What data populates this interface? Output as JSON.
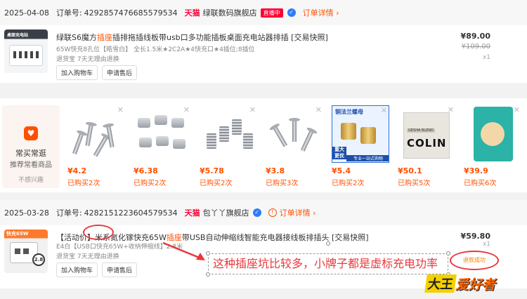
{
  "orders": [
    {
      "date": "2025-04-08",
      "order_no_label": "订单号:",
      "order_no": "4292857476685579534",
      "platform": "天猫",
      "shop": "绿联数码旗舰店",
      "live_badge": "直播中",
      "detail_label": "订单详情",
      "thumb_text": "桌面充电站",
      "title_pre": "绿联S6魔方",
      "title_hl": "插座",
      "title_post": "插排拖插线板带usb口多功能插板桌面充电站器排插 [交易快照]",
      "spec": "65W快充8孔位【皓雪白】 全长1.5米★2C2A★4快充口★4插位;8插位",
      "service": "退货宝 7天无理由退换",
      "buttons": [
        "加入购物车",
        "申请售后"
      ],
      "price": "¥89.00",
      "original_price": "¥109.00",
      "qty": "x1"
    },
    {
      "date": "2025-03-28",
      "order_no_label": "订单号:",
      "order_no": "4282151223604579534",
      "platform": "天猫",
      "shop": "包丫丫旗舰店",
      "detail_label": "订单详情",
      "thumb_text": "快充65W",
      "thumb_badge": "2.8",
      "title_pre": "【活动价】米系氮化镓快充65W",
      "title_hl": "插座",
      "title_post": "带USB自动伸缩线智能充电器接线板排插头 [交易快照]",
      "spec": "E4白【USB口快充65W+收纳伸缩线】2.8米",
      "service": "退货宝 7天无理由退换",
      "buttons": [
        "加入购物车",
        "申请售后"
      ],
      "price": "¥59.80",
      "qty": "x1",
      "status": "退款成功"
    }
  ],
  "recommend": {
    "fav_title": "常买常逛",
    "fav_sub": "推荐常看商品",
    "fav_dismiss": "不感兴趣",
    "items": [
      {
        "price": "¥4.2",
        "bought": "已购买2次",
        "icon": "screws-product"
      },
      {
        "price": "¥6.38",
        "bought": "已购买2次",
        "icon": "cylinders-product"
      },
      {
        "price": "¥5.78",
        "bought": "已购买2次",
        "icon": "inserts-product"
      },
      {
        "price": "¥3.8",
        "bought": "已购买3次",
        "icon": "bolts-product"
      },
      {
        "price": "¥5.4",
        "bought": "已购买2次",
        "icon": "brass-nut-product",
        "img_title": "铜法兰螺母",
        "img_tag1": "重大更优",
        "img_tag2": "专业一站式购物"
      },
      {
        "price": "¥50.1",
        "bought": "已购买5次",
        "icon": "coffee-product",
        "img_brand": "COLIN",
        "img_label": "GESHA BLEND"
      },
      {
        "price": "¥39.9",
        "bought": "已购买6次",
        "icon": "cat-food-product"
      }
    ]
  },
  "annotation": {
    "text": "这种插座坑比较多，小牌子都是虚标充电功率"
  },
  "watermark": {
    "part1": "大王",
    "part2": "爱好者"
  },
  "colors": {
    "accent": "#ff5000",
    "tmall": "#ff0036",
    "annotation": "#e8383d"
  }
}
